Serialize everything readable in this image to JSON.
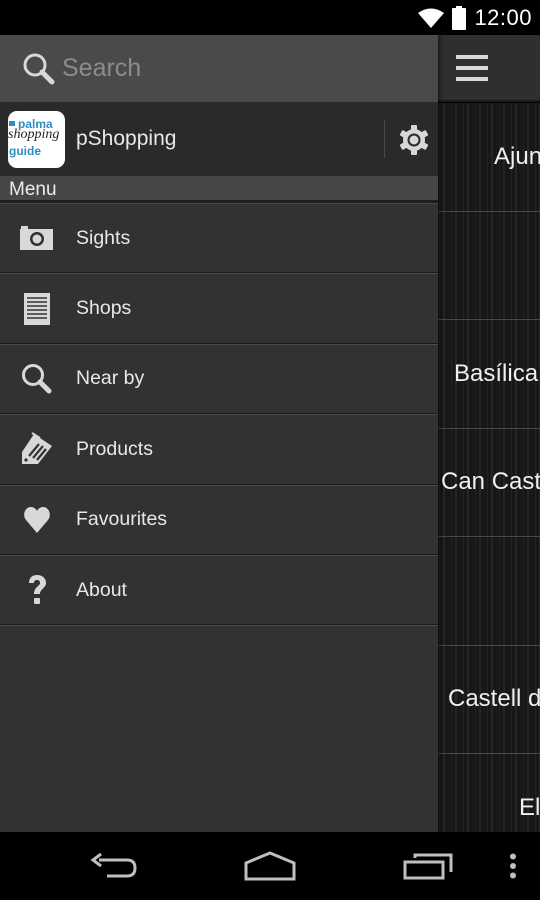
{
  "status_bar": {
    "time": "12:00",
    "icons": [
      "wifi-icon",
      "battery-icon"
    ]
  },
  "drawer": {
    "search": {
      "placeholder": "Search",
      "value": "",
      "icon": "search-icon"
    },
    "profile": {
      "app_name": "pShopping",
      "logo": {
        "line1": "palma",
        "line2": "shopping",
        "line3": "guide"
      },
      "settings_icon": "gear-icon"
    },
    "menu_header": "Menu",
    "items": [
      {
        "label": "Sights",
        "icon": "camera-icon"
      },
      {
        "label": "Shops",
        "icon": "list-document-icon"
      },
      {
        "label": "Near by",
        "icon": "search-icon"
      },
      {
        "label": "Products",
        "icon": "tag-icon"
      },
      {
        "label": "Favourites",
        "icon": "heart-icon"
      },
      {
        "label": "About",
        "icon": "question-icon"
      }
    ]
  },
  "content": {
    "menu_icon": "hamburger-icon",
    "rows": [
      {
        "label": "Ajuntament"
      },
      {
        "label": ""
      },
      {
        "label": "Basílica"
      },
      {
        "label": "Can Castell"
      },
      {
        "label": ""
      },
      {
        "label": "Castell de"
      },
      {
        "label": "El"
      }
    ]
  },
  "nav_bar": {
    "buttons": [
      "back-icon",
      "home-icon",
      "recent-apps-icon",
      "overflow-menu-icon"
    ]
  },
  "colors": {
    "drawer_bg": "#323232",
    "search_bg": "#4a4a4a",
    "profile_bg": "#2a2a2a",
    "menu_header_bg": "#474747",
    "logo_blue": "#2d8ec3"
  }
}
